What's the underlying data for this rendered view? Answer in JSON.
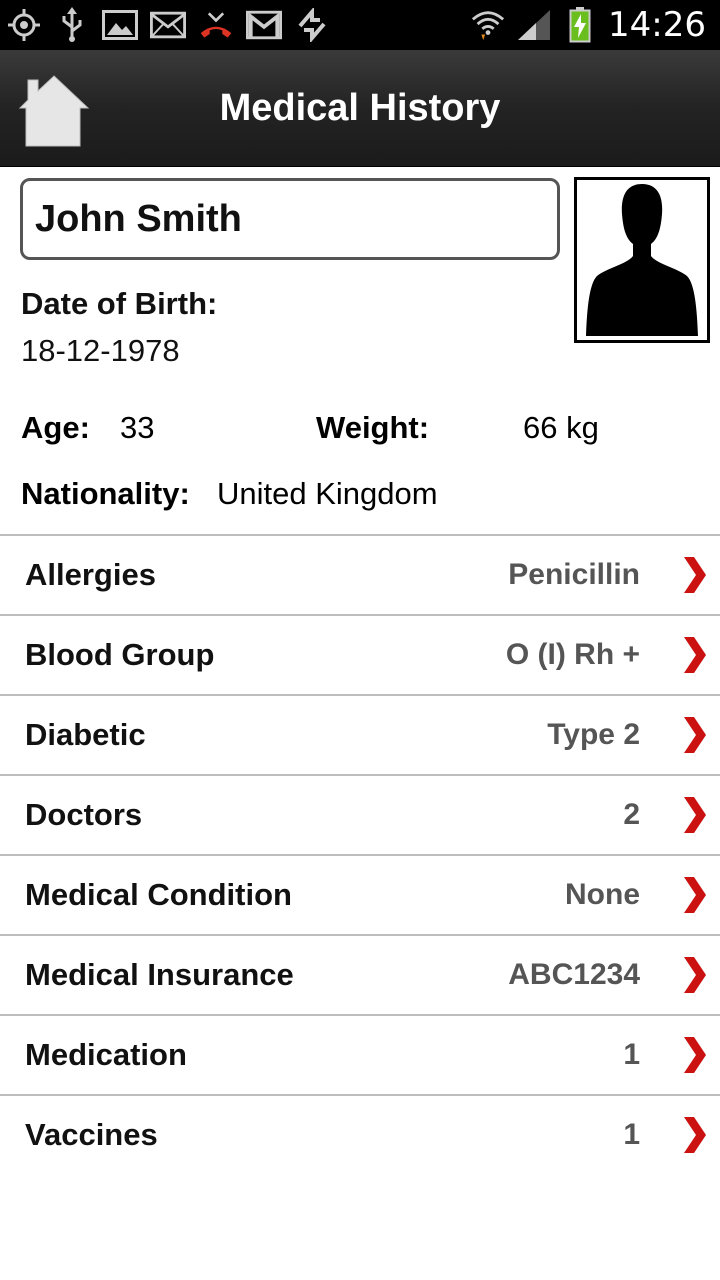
{
  "status_bar": {
    "time": "14:26",
    "icons": [
      "gps-icon",
      "usb-icon",
      "gallery-icon",
      "email-icon",
      "missed-call-icon",
      "gmail-icon",
      "sync-icon",
      "wifi-icon",
      "signal-icon",
      "battery-charging-icon"
    ]
  },
  "header": {
    "title": "Medical History",
    "home_icon": "home-icon"
  },
  "profile": {
    "name": "John Smith",
    "dob_label": "Date of Birth:",
    "dob_value": "18-12-1978",
    "age_label": "Age:",
    "age_value": "33",
    "weight_label": "Weight:",
    "weight_value": "66 kg",
    "nationality_label": "Nationality:",
    "nationality_value": "United Kingdom",
    "photo_icon": "person-silhouette-icon"
  },
  "list": {
    "items": [
      {
        "label": "Allergies",
        "value": "Penicillin"
      },
      {
        "label": "Blood Group",
        "value": "O (I) Rh +"
      },
      {
        "label": "Diabetic",
        "value": "Type 2"
      },
      {
        "label": "Doctors",
        "value": "2"
      },
      {
        "label": "Medical Condition",
        "value": "None"
      },
      {
        "label": "Medical Insurance",
        "value": "ABC1234"
      },
      {
        "label": "Medication",
        "value": "1"
      },
      {
        "label": "Vaccines",
        "value": "1"
      }
    ],
    "chevron_color": "#cc1111"
  }
}
